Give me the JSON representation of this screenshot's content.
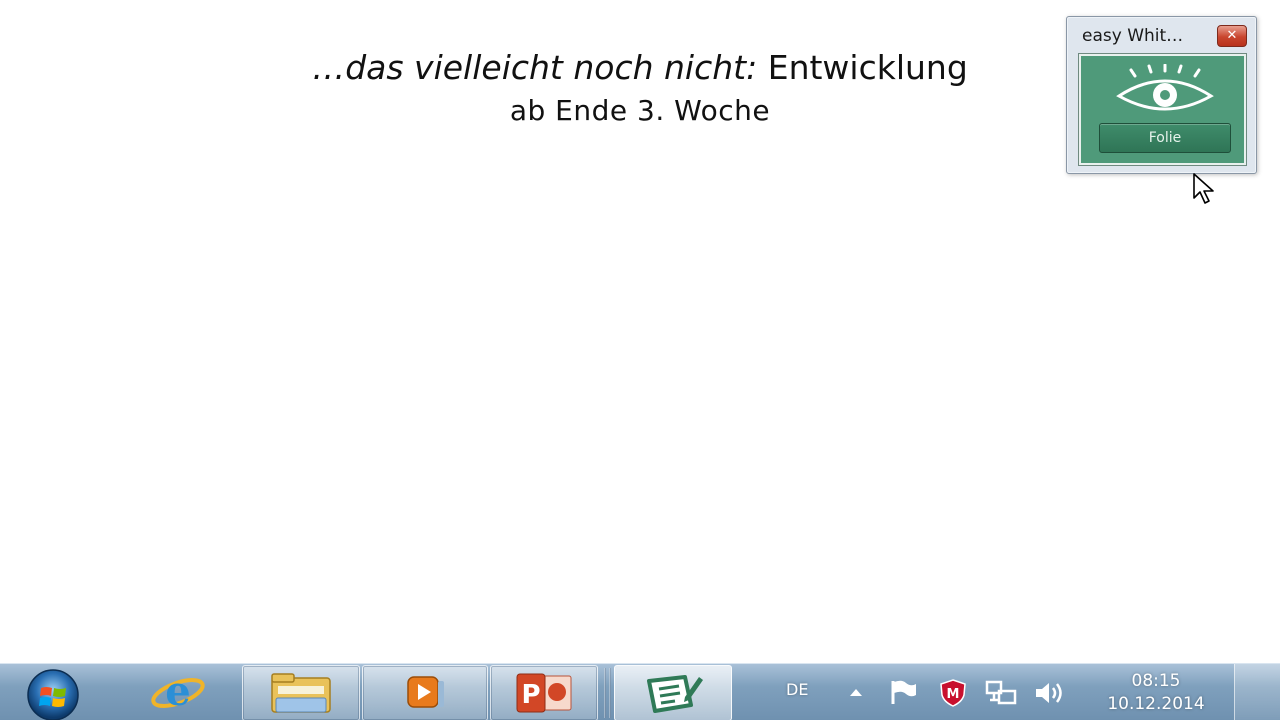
{
  "slide": {
    "title_italic": "…das vielleicht noch nicht:",
    "title_regular": "Entwicklung",
    "subtitle": "ab Ende 3. Woche"
  },
  "widget": {
    "title": "easy Whit…",
    "close_label": "✕",
    "button_label": "Folie",
    "panel_color": "#4f9a7a",
    "icon": "eye-icon"
  },
  "taskbar": {
    "items": [
      {
        "name": "start-button",
        "icon": "windows-logo-icon"
      },
      {
        "name": "internet-explorer",
        "icon": "internet-explorer-icon"
      },
      {
        "name": "windows-explorer",
        "icon": "folder-icon"
      },
      {
        "name": "media-player",
        "icon": "media-play-icon"
      },
      {
        "name": "powerpoint",
        "icon": "powerpoint-icon"
      },
      {
        "name": "easy-whiteboard",
        "icon": "whiteboard-pen-icon"
      }
    ],
    "language": "DE",
    "tray_icons": [
      "show-hidden-icons-arrow",
      "action-center-flag-icon",
      "mcafee-shield-icon",
      "network-icon",
      "volume-icon"
    ],
    "clock_time": "08:15",
    "clock_date": "10.12.2014"
  }
}
